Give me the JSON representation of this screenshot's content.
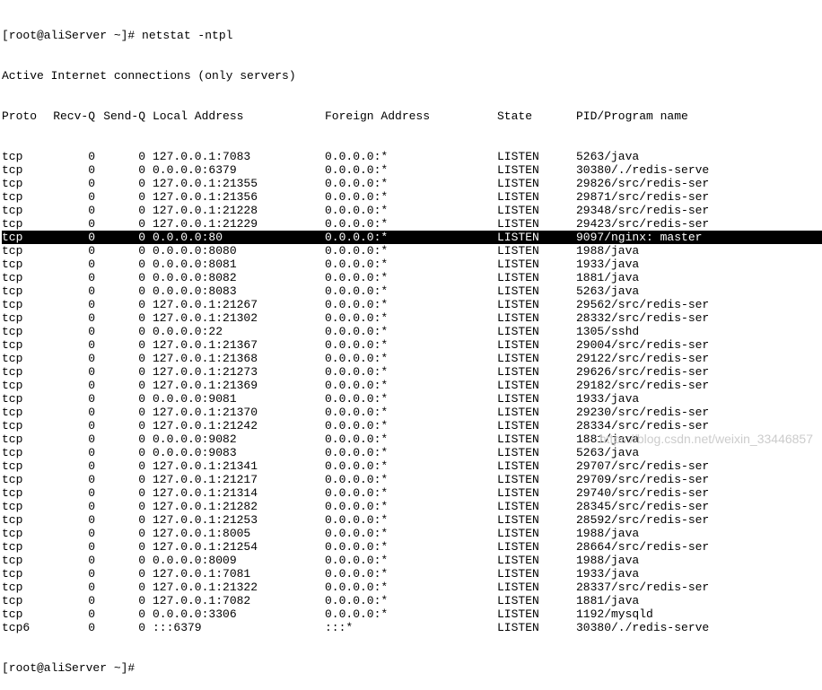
{
  "pre_lines": [
    "[root@aliServer ~]# netstat -ntpl",
    "Active Internet connections (only servers)"
  ],
  "header": {
    "proto": "Proto",
    "recvq": "Recv-Q",
    "sendq": "Send-Q",
    "local": "Local Address",
    "foreign": "Foreign Address",
    "state": "State",
    "pid": "PID/Program name"
  },
  "rows": [
    {
      "proto": "tcp",
      "recvq": "0",
      "sendq": "0",
      "local": "127.0.0.1:7083",
      "foreign": "0.0.0.0:*",
      "state": "LISTEN",
      "pid": "5263/java",
      "hl": false
    },
    {
      "proto": "tcp",
      "recvq": "0",
      "sendq": "0",
      "local": "0.0.0.0:6379",
      "foreign": "0.0.0.0:*",
      "state": "LISTEN",
      "pid": "30380/./redis-serve",
      "hl": false
    },
    {
      "proto": "tcp",
      "recvq": "0",
      "sendq": "0",
      "local": "127.0.0.1:21355",
      "foreign": "0.0.0.0:*",
      "state": "LISTEN",
      "pid": "29826/src/redis-ser",
      "hl": false
    },
    {
      "proto": "tcp",
      "recvq": "0",
      "sendq": "0",
      "local": "127.0.0.1:21356",
      "foreign": "0.0.0.0:*",
      "state": "LISTEN",
      "pid": "29871/src/redis-ser",
      "hl": false
    },
    {
      "proto": "tcp",
      "recvq": "0",
      "sendq": "0",
      "local": "127.0.0.1:21228",
      "foreign": "0.0.0.0:*",
      "state": "LISTEN",
      "pid": "29348/src/redis-ser",
      "hl": false
    },
    {
      "proto": "tcp",
      "recvq": "0",
      "sendq": "0",
      "local": "127.0.0.1:21229",
      "foreign": "0.0.0.0:*",
      "state": "LISTEN",
      "pid": "29423/src/redis-ser",
      "hl": false
    },
    {
      "proto": "tcp",
      "recvq": "0",
      "sendq": "0",
      "local": "0.0.0.0:80",
      "foreign": "0.0.0.0:*",
      "state": "LISTEN",
      "pid": "9097/nginx: master ",
      "hl": true
    },
    {
      "proto": "tcp",
      "recvq": "0",
      "sendq": "0",
      "local": "0.0.0.0:8080",
      "foreign": "0.0.0.0:*",
      "state": "LISTEN",
      "pid": "1988/java",
      "hl": false
    },
    {
      "proto": "tcp",
      "recvq": "0",
      "sendq": "0",
      "local": "0.0.0.0:8081",
      "foreign": "0.0.0.0:*",
      "state": "LISTEN",
      "pid": "1933/java",
      "hl": false
    },
    {
      "proto": "tcp",
      "recvq": "0",
      "sendq": "0",
      "local": "0.0.0.0:8082",
      "foreign": "0.0.0.0:*",
      "state": "LISTEN",
      "pid": "1881/java",
      "hl": false
    },
    {
      "proto": "tcp",
      "recvq": "0",
      "sendq": "0",
      "local": "0.0.0.0:8083",
      "foreign": "0.0.0.0:*",
      "state": "LISTEN",
      "pid": "5263/java",
      "hl": false
    },
    {
      "proto": "tcp",
      "recvq": "0",
      "sendq": "0",
      "local": "127.0.0.1:21267",
      "foreign": "0.0.0.0:*",
      "state": "LISTEN",
      "pid": "29562/src/redis-ser",
      "hl": false
    },
    {
      "proto": "tcp",
      "recvq": "0",
      "sendq": "0",
      "local": "127.0.0.1:21302",
      "foreign": "0.0.0.0:*",
      "state": "LISTEN",
      "pid": "28332/src/redis-ser",
      "hl": false
    },
    {
      "proto": "tcp",
      "recvq": "0",
      "sendq": "0",
      "local": "0.0.0.0:22",
      "foreign": "0.0.0.0:*",
      "state": "LISTEN",
      "pid": "1305/sshd",
      "hl": false
    },
    {
      "proto": "tcp",
      "recvq": "0",
      "sendq": "0",
      "local": "127.0.0.1:21367",
      "foreign": "0.0.0.0:*",
      "state": "LISTEN",
      "pid": "29004/src/redis-ser",
      "hl": false
    },
    {
      "proto": "tcp",
      "recvq": "0",
      "sendq": "0",
      "local": "127.0.0.1:21368",
      "foreign": "0.0.0.0:*",
      "state": "LISTEN",
      "pid": "29122/src/redis-ser",
      "hl": false
    },
    {
      "proto": "tcp",
      "recvq": "0",
      "sendq": "0",
      "local": "127.0.0.1:21273",
      "foreign": "0.0.0.0:*",
      "state": "LISTEN",
      "pid": "29626/src/redis-ser",
      "hl": false
    },
    {
      "proto": "tcp",
      "recvq": "0",
      "sendq": "0",
      "local": "127.0.0.1:21369",
      "foreign": "0.0.0.0:*",
      "state": "LISTEN",
      "pid": "29182/src/redis-ser",
      "hl": false
    },
    {
      "proto": "tcp",
      "recvq": "0",
      "sendq": "0",
      "local": "0.0.0.0:9081",
      "foreign": "0.0.0.0:*",
      "state": "LISTEN",
      "pid": "1933/java",
      "hl": false
    },
    {
      "proto": "tcp",
      "recvq": "0",
      "sendq": "0",
      "local": "127.0.0.1:21370",
      "foreign": "0.0.0.0:*",
      "state": "LISTEN",
      "pid": "29230/src/redis-ser",
      "hl": false
    },
    {
      "proto": "tcp",
      "recvq": "0",
      "sendq": "0",
      "local": "127.0.0.1:21242",
      "foreign": "0.0.0.0:*",
      "state": "LISTEN",
      "pid": "28334/src/redis-ser",
      "hl": false
    },
    {
      "proto": "tcp",
      "recvq": "0",
      "sendq": "0",
      "local": "0.0.0.0:9082",
      "foreign": "0.0.0.0:*",
      "state": "LISTEN",
      "pid": "1881/java",
      "hl": false
    },
    {
      "proto": "tcp",
      "recvq": "0",
      "sendq": "0",
      "local": "0.0.0.0:9083",
      "foreign": "0.0.0.0:*",
      "state": "LISTEN",
      "pid": "5263/java",
      "hl": false
    },
    {
      "proto": "tcp",
      "recvq": "0",
      "sendq": "0",
      "local": "127.0.0.1:21341",
      "foreign": "0.0.0.0:*",
      "state": "LISTEN",
      "pid": "29707/src/redis-ser",
      "hl": false
    },
    {
      "proto": "tcp",
      "recvq": "0",
      "sendq": "0",
      "local": "127.0.0.1:21217",
      "foreign": "0.0.0.0:*",
      "state": "LISTEN",
      "pid": "29709/src/redis-ser",
      "hl": false
    },
    {
      "proto": "tcp",
      "recvq": "0",
      "sendq": "0",
      "local": "127.0.0.1:21314",
      "foreign": "0.0.0.0:*",
      "state": "LISTEN",
      "pid": "29740/src/redis-ser",
      "hl": false
    },
    {
      "proto": "tcp",
      "recvq": "0",
      "sendq": "0",
      "local": "127.0.0.1:21282",
      "foreign": "0.0.0.0:*",
      "state": "LISTEN",
      "pid": "28345/src/redis-ser",
      "hl": false
    },
    {
      "proto": "tcp",
      "recvq": "0",
      "sendq": "0",
      "local": "127.0.0.1:21253",
      "foreign": "0.0.0.0:*",
      "state": "LISTEN",
      "pid": "28592/src/redis-ser",
      "hl": false
    },
    {
      "proto": "tcp",
      "recvq": "0",
      "sendq": "0",
      "local": "127.0.0.1:8005",
      "foreign": "0.0.0.0:*",
      "state": "LISTEN",
      "pid": "1988/java",
      "hl": false
    },
    {
      "proto": "tcp",
      "recvq": "0",
      "sendq": "0",
      "local": "127.0.0.1:21254",
      "foreign": "0.0.0.0:*",
      "state": "LISTEN",
      "pid": "28664/src/redis-ser",
      "hl": false
    },
    {
      "proto": "tcp",
      "recvq": "0",
      "sendq": "0",
      "local": "0.0.0.0:8009",
      "foreign": "0.0.0.0:*",
      "state": "LISTEN",
      "pid": "1988/java",
      "hl": false
    },
    {
      "proto": "tcp",
      "recvq": "0",
      "sendq": "0",
      "local": "127.0.0.1:7081",
      "foreign": "0.0.0.0:*",
      "state": "LISTEN",
      "pid": "1933/java",
      "hl": false
    },
    {
      "proto": "tcp",
      "recvq": "0",
      "sendq": "0",
      "local": "127.0.0.1:21322",
      "foreign": "0.0.0.0:*",
      "state": "LISTEN",
      "pid": "28337/src/redis-ser",
      "hl": false
    },
    {
      "proto": "tcp",
      "recvq": "0",
      "sendq": "0",
      "local": "127.0.0.1:7082",
      "foreign": "0.0.0.0:*",
      "state": "LISTEN",
      "pid": "1881/java",
      "hl": false
    },
    {
      "proto": "tcp",
      "recvq": "0",
      "sendq": "0",
      "local": "0.0.0.0:3306",
      "foreign": "0.0.0.0:*",
      "state": "LISTEN",
      "pid": "1192/mysqld",
      "hl": false
    },
    {
      "proto": "tcp6",
      "recvq": "0",
      "sendq": "0",
      "local": ":::6379",
      "foreign": ":::*",
      "state": "LISTEN",
      "pid": "30380/./redis-serve",
      "hl": false
    }
  ],
  "post_line": "[root@aliServer ~]# ",
  "watermark": "https://blog.csdn.net/weixin_33446857"
}
